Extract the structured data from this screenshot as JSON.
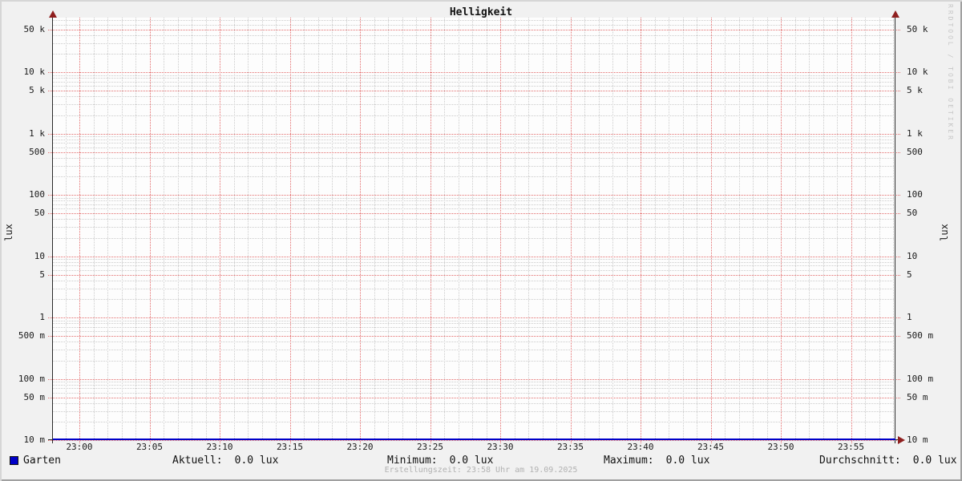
{
  "title": "Helligkeit",
  "watermark": "RRDTOOL / TOBI OETIKER",
  "y_axis": {
    "unit_label": "lux",
    "ticks": [
      {
        "label": "50 k",
        "value": 50000
      },
      {
        "label": "10 k",
        "value": 10000
      },
      {
        "label": "5 k",
        "value": 5000
      },
      {
        "label": "1 k",
        "value": 1000
      },
      {
        "label": "500",
        "value": 500
      },
      {
        "label": "100",
        "value": 100
      },
      {
        "label": "50",
        "value": 50
      },
      {
        "label": "10",
        "value": 10
      },
      {
        "label": "5",
        "value": 5
      },
      {
        "label": "1",
        "value": 1
      },
      {
        "label": "500 m",
        "value": 0.5
      },
      {
        "label": "100 m",
        "value": 0.1
      },
      {
        "label": "50 m",
        "value": 0.05
      },
      {
        "label": "10 m",
        "value": 0.01
      }
    ]
  },
  "x_axis": {
    "ticks": [
      {
        "label": "23:00",
        "minute": 0
      },
      {
        "label": "23:05",
        "minute": 5
      },
      {
        "label": "23:10",
        "minute": 10
      },
      {
        "label": "23:15",
        "minute": 15
      },
      {
        "label": "23:20",
        "minute": 20
      },
      {
        "label": "23:25",
        "minute": 25
      },
      {
        "label": "23:30",
        "minute": 30
      },
      {
        "label": "23:35",
        "minute": 35
      },
      {
        "label": "23:40",
        "minute": 40
      },
      {
        "label": "23:45",
        "minute": 45
      },
      {
        "label": "23:50",
        "minute": 50
      },
      {
        "label": "23:55",
        "minute": 55
      }
    ]
  },
  "legend": {
    "series_label": "Garten",
    "series_color": "#0000C8"
  },
  "stats": [
    {
      "label": "Aktuell:",
      "value": "0.0 lux"
    },
    {
      "label": "Minimum:",
      "value": "0.0 lux"
    },
    {
      "label": "Maximum:",
      "value": "0.0 lux"
    },
    {
      "label": "Durchschnitt:",
      "value": "0.0 lux"
    }
  ],
  "footer": "Erstellungszeit: 23:58 Uhr am 19.09.2025",
  "colors": {
    "background": "#f1f1f1",
    "canvas": "#fdfdfd",
    "major_grid": "#e36b6b",
    "minor_grid": "#cbcbcb",
    "axis": "#2b2b2b",
    "arrow": "#8f1f1f",
    "series": "#0000C8"
  },
  "chart_data": {
    "type": "line",
    "title": "Helligkeit",
    "xlabel": "",
    "ylabel": "lux",
    "y_scale": "logarithmic",
    "ylim": [
      0.01,
      78000
    ],
    "x_range": [
      "22:58",
      "23:58"
    ],
    "x_tick_labels": [
      "23:00",
      "23:05",
      "23:10",
      "23:15",
      "23:20",
      "23:25",
      "23:30",
      "23:35",
      "23:40",
      "23:45",
      "23:50",
      "23:55"
    ],
    "y_tick_labels": [
      "50 k",
      "10 k",
      "5 k",
      "1 k",
      "500",
      "100",
      "50",
      "10",
      "5",
      "1",
      "500 m",
      "100 m",
      "50 m",
      "10 m"
    ],
    "y_tick_values": [
      50000,
      10000,
      5000,
      1000,
      500,
      100,
      50,
      10,
      5,
      1,
      0.5,
      0.1,
      0.05,
      0.01
    ],
    "grid": true,
    "legend_position": "bottom",
    "series": [
      {
        "name": "Garten",
        "color": "#0000C8",
        "x": [
          "23:00",
          "23:05",
          "23:10",
          "23:15",
          "23:20",
          "23:25",
          "23:30",
          "23:35",
          "23:40",
          "23:45",
          "23:50",
          "23:55"
        ],
        "values": [
          0.0,
          0.0,
          0.0,
          0.0,
          0.0,
          0.0,
          0.0,
          0.0,
          0.0,
          0.0,
          0.0,
          0.0
        ]
      }
    ],
    "stats": {
      "aktuell": 0.0,
      "minimum": 0.0,
      "maximum": 0.0,
      "durchschnitt": 0.0,
      "unit": "lux"
    }
  }
}
